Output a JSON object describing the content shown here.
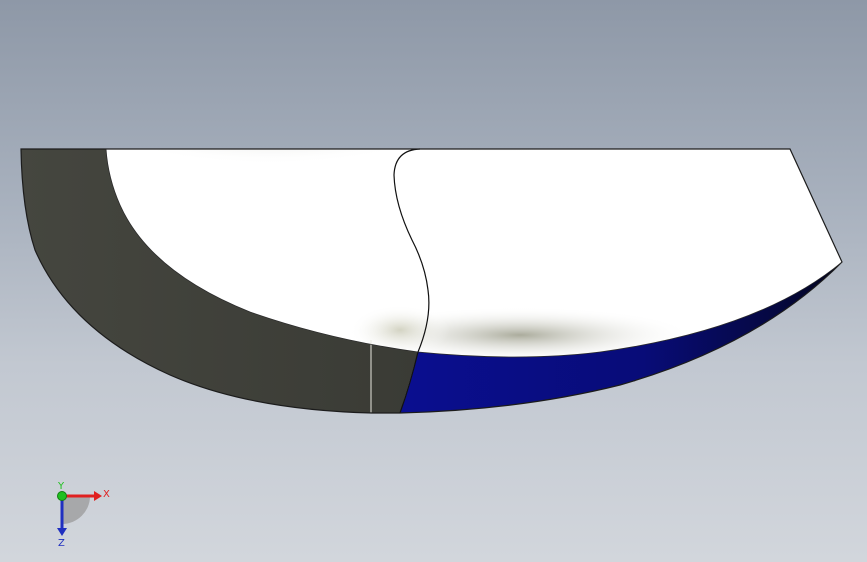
{
  "viewport": {
    "background_top": "#8e98a7",
    "background_bottom": "#d2d6dc"
  },
  "model": {
    "colors": {
      "dark_face": "#3f403a",
      "light_face": "#ffffff",
      "shadow": "#4a4b42",
      "blue_face": "#0b0f8c",
      "edge": "#1a1a1a"
    }
  },
  "triad": {
    "x_label": "X",
    "y_label": "Y",
    "z_label": "Z",
    "x_color": "#e02020",
    "y_color": "#20c020",
    "z_color": "#2030c0"
  }
}
